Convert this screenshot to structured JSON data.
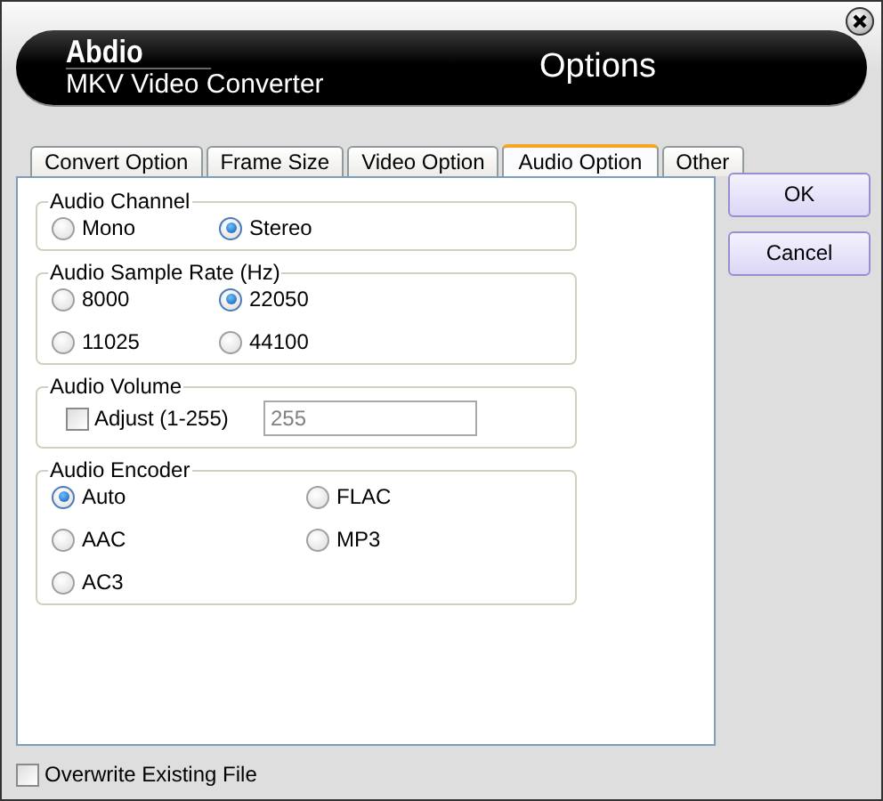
{
  "header": {
    "brand": "Abdio",
    "product": "MKV Video Converter",
    "title": "Options"
  },
  "tabs": [
    {
      "label": "Convert Option",
      "selected": false
    },
    {
      "label": "Frame Size",
      "selected": false
    },
    {
      "label": "Video Option",
      "selected": false
    },
    {
      "label": "Audio Option",
      "selected": true
    },
    {
      "label": "Other",
      "selected": false
    }
  ],
  "groups": [
    {
      "title": "Audio Channel",
      "kind": "radios",
      "options": [
        {
          "label": "Mono",
          "selected": false
        },
        {
          "label": "Stereo",
          "selected": true
        }
      ]
    },
    {
      "title": "Audio Sample Rate (Hz)",
      "kind": "radios",
      "options": [
        {
          "label": "8000",
          "selected": false
        },
        {
          "label": "22050",
          "selected": true
        },
        {
          "label": "11025",
          "selected": false
        },
        {
          "label": "44100",
          "selected": false
        }
      ]
    },
    {
      "title": "Audio Volume",
      "kind": "volume",
      "checkbox": {
        "label": "Adjust (1-255)",
        "checked": false
      },
      "field": {
        "value": "255",
        "disabled": true
      }
    },
    {
      "title": "Audio Encoder",
      "kind": "radios",
      "options": [
        {
          "label": "Auto",
          "selected": true
        },
        {
          "label": "FLAC",
          "selected": false
        },
        {
          "label": "AAC",
          "selected": false
        },
        {
          "label": "MP3",
          "selected": false
        },
        {
          "label": "AC3",
          "selected": false
        }
      ]
    }
  ],
  "buttons": [
    "OK",
    "Cancel"
  ],
  "overwrite": {
    "label": "Overwrite Existing File",
    "checked": false
  }
}
